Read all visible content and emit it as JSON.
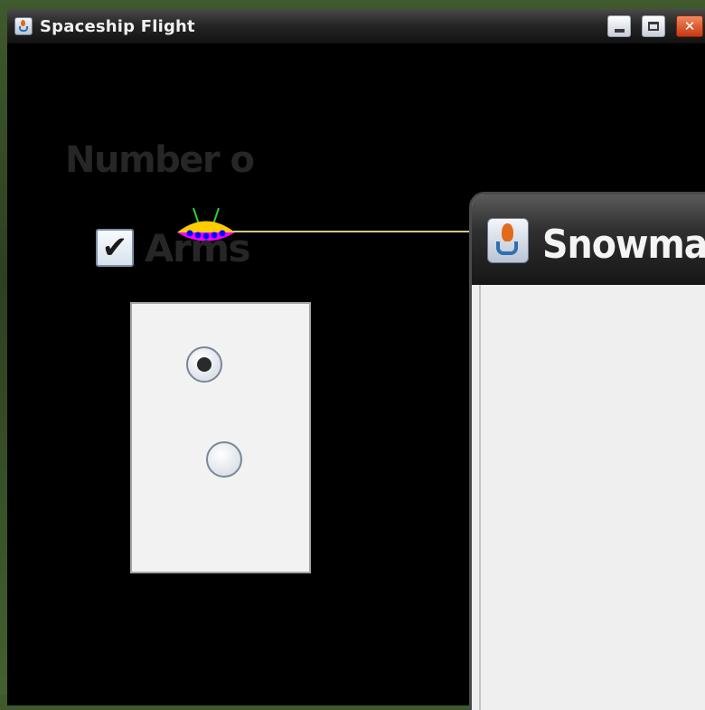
{
  "main_window": {
    "title": "Spaceship Flight",
    "controls": {
      "minimize": "minimize",
      "maximize": "maximize",
      "close": "✕"
    }
  },
  "snowman_dialog": {
    "title": "Snowman",
    "count_label": "Number o",
    "arms": {
      "label": "Arms",
      "checked": true,
      "check_glyph": "✔"
    },
    "radios": [
      {
        "selected": true
      },
      {
        "selected": false
      }
    ]
  },
  "colors": {
    "canvas_background": "#000000",
    "trajectory": "#d7c97a",
    "ship_top": "#ffcc00",
    "ship_bottom": "#ff00ff",
    "ship_lights": "#0000ff",
    "ship_antennae": "#33cc33"
  }
}
